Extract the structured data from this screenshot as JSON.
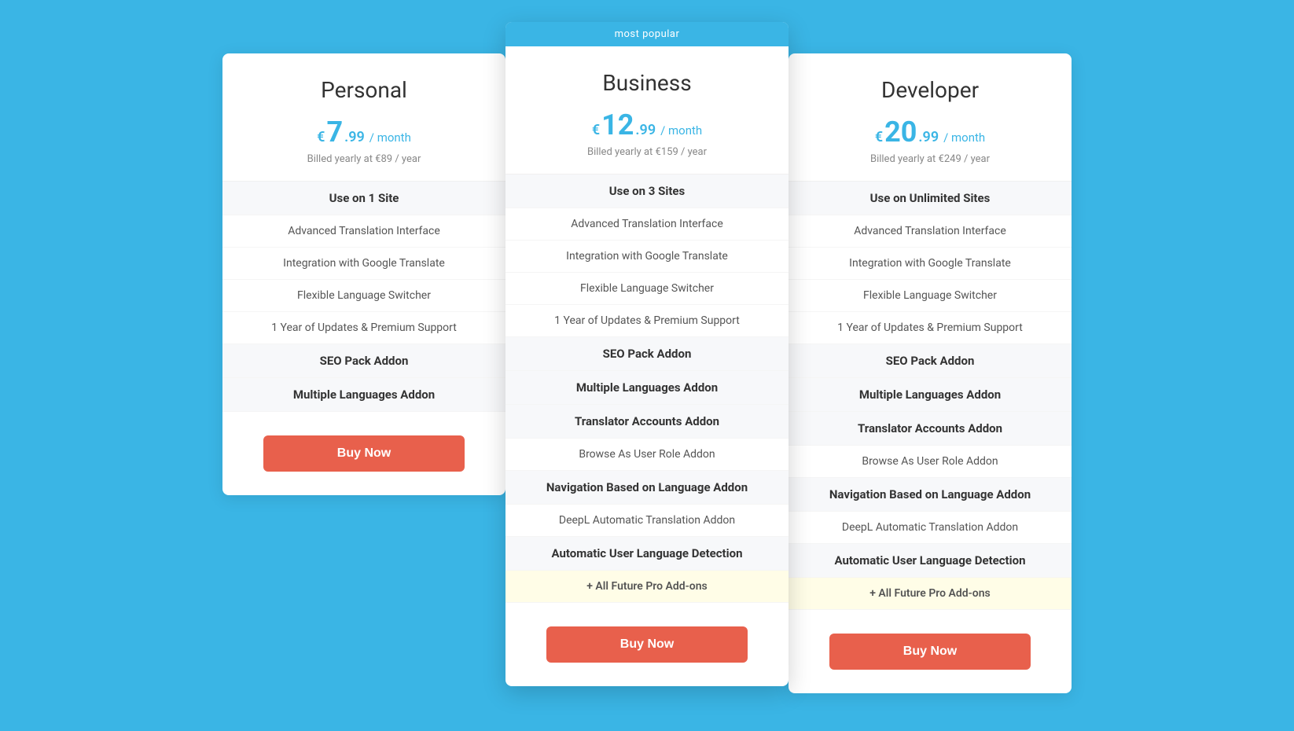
{
  "plans": [
    {
      "id": "personal",
      "name": "Personal",
      "featured": false,
      "currency_symbol": "€",
      "price_main": "7",
      "price_decimal": ".99",
      "period": "/ month",
      "billed": "Billed yearly at €89 / year",
      "features": [
        {
          "label": "Use on 1 Site",
          "highlight": true
        },
        {
          "label": "Advanced Translation Interface",
          "highlight": false
        },
        {
          "label": "Integration with Google Translate",
          "highlight": false
        },
        {
          "label": "Flexible Language Switcher",
          "highlight": false
        },
        {
          "label": "1 Year of Updates & Premium Support",
          "highlight": false
        },
        {
          "label": "SEO Pack Addon",
          "highlight": true
        },
        {
          "label": "Multiple Languages Addon",
          "highlight": true
        }
      ],
      "button_label": "Buy Now"
    },
    {
      "id": "business",
      "name": "Business",
      "featured": true,
      "most_popular": "most popular",
      "currency_symbol": "€",
      "price_main": "12",
      "price_decimal": ".99",
      "period": "/ month",
      "billed": "Billed yearly at €159 / year",
      "features": [
        {
          "label": "Use on 3 Sites",
          "highlight": true
        },
        {
          "label": "Advanced Translation Interface",
          "highlight": false
        },
        {
          "label": "Integration with Google Translate",
          "highlight": false
        },
        {
          "label": "Flexible Language Switcher",
          "highlight": false
        },
        {
          "label": "1 Year of Updates & Premium Support",
          "highlight": false
        },
        {
          "label": "SEO Pack Addon",
          "highlight": true
        },
        {
          "label": "Multiple Languages Addon",
          "highlight": true
        },
        {
          "label": "Translator Accounts Addon",
          "highlight": true
        },
        {
          "label": "Browse As User Role Addon",
          "highlight": false
        },
        {
          "label": "Navigation Based on Language Addon",
          "highlight": true
        },
        {
          "label": "DeepL Automatic Translation Addon",
          "highlight": false
        },
        {
          "label": "Automatic User Language Detection",
          "highlight": true
        },
        {
          "label": "+ All Future Pro Add-ons",
          "highlight": false,
          "future": true
        }
      ],
      "button_label": "Buy Now"
    },
    {
      "id": "developer",
      "name": "Developer",
      "featured": false,
      "currency_symbol": "€",
      "price_main": "20",
      "price_decimal": ".99",
      "period": "/ month",
      "billed": "Billed yearly at €249 / year",
      "features": [
        {
          "label": "Use on Unlimited Sites",
          "highlight": true
        },
        {
          "label": "Advanced Translation Interface",
          "highlight": false
        },
        {
          "label": "Integration with Google Translate",
          "highlight": false
        },
        {
          "label": "Flexible Language Switcher",
          "highlight": false
        },
        {
          "label": "1 Year of Updates & Premium Support",
          "highlight": false
        },
        {
          "label": "SEO Pack Addon",
          "highlight": true
        },
        {
          "label": "Multiple Languages Addon",
          "highlight": true
        },
        {
          "label": "Translator Accounts Addon",
          "highlight": true
        },
        {
          "label": "Browse As User Role Addon",
          "highlight": false
        },
        {
          "label": "Navigation Based on Language Addon",
          "highlight": true
        },
        {
          "label": "DeepL Automatic Translation Addon",
          "highlight": false
        },
        {
          "label": "Automatic User Language Detection",
          "highlight": true
        },
        {
          "label": "+ All Future Pro Add-ons",
          "highlight": false,
          "future": true
        }
      ],
      "button_label": "Buy Now"
    }
  ]
}
